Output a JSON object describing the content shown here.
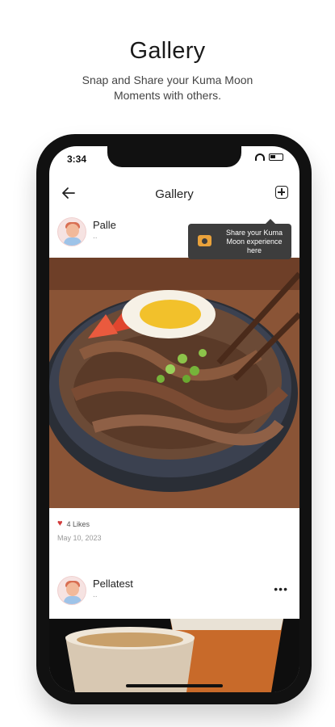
{
  "promo": {
    "title": "Gallery",
    "subtitle_line1": "Snap and Share your Kuma Moon",
    "subtitle_line2": "Moments with others."
  },
  "status_bar": {
    "time": "3:34"
  },
  "navbar": {
    "title": "Gallery",
    "back_icon": "arrow-left-icon",
    "add_icon": "plus-square-icon"
  },
  "tooltip": {
    "text": "Share your Kuma Moon experience here",
    "icon": "camera-icon"
  },
  "posts": [
    {
      "user": "Palle",
      "subtitle": "..",
      "likes": "4 Likes",
      "date": "May 10, 2023",
      "image": "beef-rice-bowl"
    },
    {
      "user": "Pellatest",
      "subtitle": "..",
      "image": "iced-drinks"
    }
  ],
  "colors": {
    "heart": "#d23a3a",
    "tooltip_bg": "#3d3d3d",
    "camera": "#e9a23b"
  }
}
